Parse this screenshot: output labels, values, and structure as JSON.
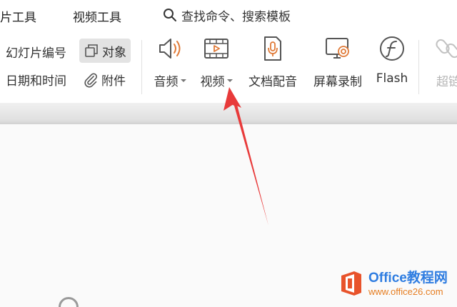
{
  "tabs": [
    {
      "label": "片工具"
    },
    {
      "label": "视频工具"
    }
  ],
  "search": {
    "placeholder": "查找命令、搜索模板"
  },
  "ribbon": {
    "small": {
      "slide_number": "幻灯片编号",
      "object": "对象",
      "date_time": "日期和时间",
      "attachment": "附件"
    },
    "buttons": {
      "audio": "音频",
      "video": "视频",
      "doc_dub": "文档配音",
      "screen_record": "屏幕录制",
      "flash": "Flash",
      "hyperlink": "超链"
    }
  },
  "watermark": {
    "title": "Office教程网",
    "url": "www.office26.com"
  },
  "colors": {
    "accent_orange": "#e07b39",
    "arrow_red": "#e83a3a",
    "brand_blue": "#2f7de1"
  }
}
